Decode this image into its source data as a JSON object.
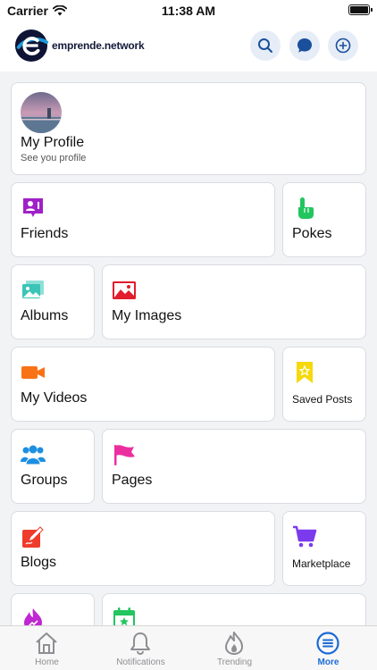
{
  "status_bar": {
    "carrier": "Carrier",
    "time": "11:38 AM"
  },
  "header": {
    "brand": "emprende.network",
    "actions": [
      "search-icon",
      "chat-icon",
      "add-icon"
    ]
  },
  "menu": {
    "profile": {
      "label": "My Profile",
      "subtitle": "See you profile"
    },
    "friends": {
      "label": "Friends",
      "icon": "friends-icon",
      "color": "#a020c8"
    },
    "pokes": {
      "label": "Pokes",
      "icon": "poke-hand-icon",
      "color": "#22c55e"
    },
    "albums": {
      "label": "Albums",
      "icon": "albums-icon",
      "color": "#3bc4b8"
    },
    "my_images": {
      "label": "My Images",
      "icon": "image-icon",
      "color": "#e11d2e"
    },
    "my_videos": {
      "label": "My Videos",
      "icon": "video-camera-icon",
      "color": "#f97316"
    },
    "saved_posts": {
      "label": "Saved Posts",
      "icon": "bookmark-star-icon",
      "color": "#f5d90a"
    },
    "groups": {
      "label": "Groups",
      "icon": "groups-icon",
      "color": "#1d8fe1"
    },
    "pages": {
      "label": "Pages",
      "icon": "flag-icon",
      "color": "#ec2fa0"
    },
    "blogs": {
      "label": "Blogs",
      "icon": "blog-edit-icon",
      "color": "#ef3b2c"
    },
    "marketplace": {
      "label": "Marketplace",
      "icon": "cart-icon",
      "color": "#7c3aed"
    }
  },
  "tabs": [
    {
      "label": "Home",
      "icon": "home-icon",
      "active": false
    },
    {
      "label": "Notifications",
      "icon": "bell-icon",
      "active": false
    },
    {
      "label": "Trending",
      "icon": "fire-icon",
      "active": false
    },
    {
      "label": "More",
      "icon": "more-menu-icon",
      "active": true
    }
  ]
}
